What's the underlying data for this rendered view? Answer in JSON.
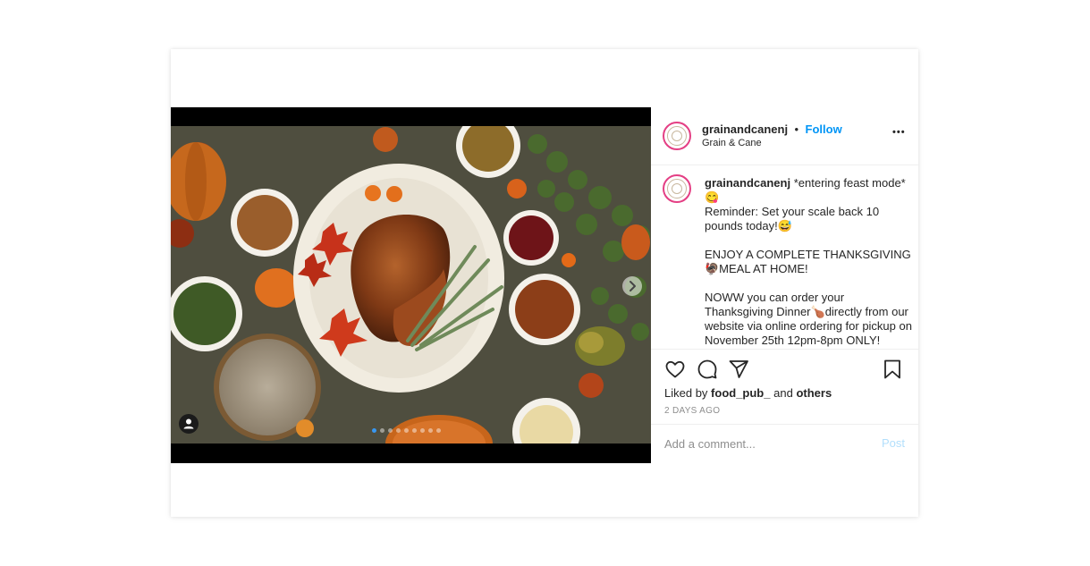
{
  "post": {
    "username": "grainandcanenj",
    "follow_label": "Follow",
    "separator": "•",
    "location": "Grain & Cane",
    "more_label": "•••",
    "caption": {
      "username": "grainandcanenj",
      "text": "*entering feast mode* 😋\nReminder: Set your scale back 10 pounds today!😅\n\nENJOY A COMPLETE THANKSGIVING 🦃MEAL AT HOME!\n\nNOWW you can order your Thanksgiving Dinner🍗directly from our website via online ordering for pickup on November 25th 12pm-8pm ONLY!"
    },
    "likes": {
      "prefix": "Liked by",
      "user": "food_pub_",
      "connector": "and",
      "others": "others"
    },
    "timestamp": "2 DAYS AGO",
    "comment": {
      "placeholder": "Add a comment...",
      "post_label": "Post"
    },
    "carousel": {
      "slide_count": 9,
      "active_index": 0
    },
    "colors": {
      "follow": "#0095f6",
      "post_disabled": "#b2dffc",
      "avatar_ring": "#e43f84",
      "active_dot": "#3897f0"
    },
    "icons": [
      "heart-icon",
      "comment-icon",
      "share-icon",
      "bookmark-icon",
      "chevron-right-icon",
      "user-tag-icon"
    ]
  }
}
